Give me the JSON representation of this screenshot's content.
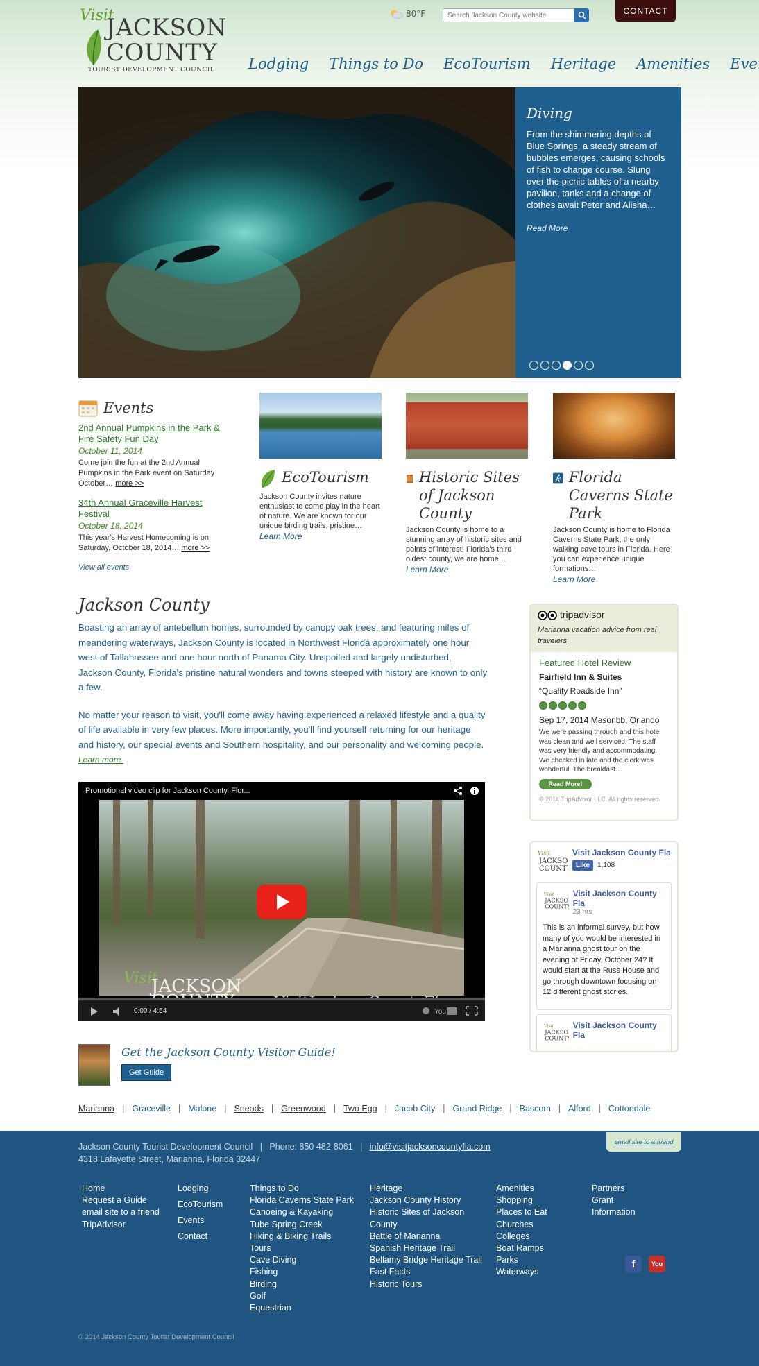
{
  "header": {
    "logo": {
      "visit": "Visit",
      "jackson": "JACKSON",
      "county": "COUNTY",
      "subtitle": "TOURIST DEVELOPMENT COUNCIL"
    },
    "weather": {
      "temp": "80°F",
      "icon": "partly-cloudy-icon"
    },
    "search": {
      "placeholder": "Search Jackson County website"
    },
    "contact_label": "CONTACT",
    "nav": [
      "Lodging",
      "Things to Do",
      "EcoTourism",
      "Heritage",
      "Amenities",
      "Events"
    ]
  },
  "hero": {
    "title": "Diving",
    "text": "From the shimmering depths of Blue Springs, a steady stream of bubbles emerges, causing schools of fish to change course. Slung over the picnic tables of a nearby pavilion, tanks and a change of clothes await Peter and Alisha…",
    "read_more": "Read More",
    "slide_count": 6,
    "active_slide": 4
  },
  "events": {
    "title": "Events",
    "items": [
      {
        "title": "2nd Annual Pumpkins in the Park & Fire Safety Fun Day",
        "date": "October 11, 2014",
        "text": "Come join the fun at the 2nd Annual Pumpkins in the Park event on Saturday October…",
        "more": "more >>"
      },
      {
        "title": "34th Annual Graceville Harvest Festival",
        "date": "October 18, 2014",
        "text": "This year's Harvest Homecoming  is on Saturday, October 18, 2014…",
        "more": "more >>"
      }
    ],
    "view_all": "View all events"
  },
  "features": [
    {
      "title": "EcoTourism",
      "icon": "leaf-icon",
      "text": "Jackson County invites nature enthusiast to come play in the heart of nature. We are known for our unique birding trails, pristine…",
      "more": "Learn More"
    },
    {
      "title": "Historic Sites of Jackson County",
      "icon": "scroll-icon",
      "text": "Jackson County is home to a stunning array of historic sites and points of interest! Florida's third oldest county, we are home…",
      "more": "Learn More"
    },
    {
      "title": "Florida Caverns State Park",
      "icon": "hiker-icon",
      "text": "Jackson County is home to Florida Caverns State Park, the only walking cave tours in Florida. Here you can experience unique formations…",
      "more": "Learn More"
    }
  ],
  "about": {
    "title": "Jackson County",
    "p1": "Boasting an array of antebellum homes, surrounded by canopy oak trees, and featuring miles of meandering waterways, Jackson County is located in Northwest Florida approximately one hour west of Tallahassee and one hour north of Panama City. Unspoiled and largely undisturbed, Jackson County, Florida's pristine natural wonders and towns steeped with history are known to only a few.",
    "p2": "No matter your reason to visit, you'll come away having experienced a relaxed lifestyle and a quality of life available in very few places.  More importantly, you'll find yourself returning for our heritage and history, our special events and Southern hospitality, and our personality and welcoming people. ",
    "learn_more": "Learn more."
  },
  "video": {
    "title": "Promotional video clip for Jackson County, Flor...",
    "time": "0:00 / 4:54",
    "watermark_visit": "Visit",
    "watermark_jackson": "JACKSON",
    "watermark_county": "COUNTY",
    "watermark_url": "www.VisitJacksonCountyFla.com"
  },
  "guide": {
    "title": "Get the Jackson County Visitor Guide!",
    "button": "Get Guide"
  },
  "towns": [
    {
      "name": "Marianna",
      "underlined": true
    },
    {
      "name": "Graceville",
      "underlined": false
    },
    {
      "name": "Malone",
      "underlined": false
    },
    {
      "name": "Sneads",
      "underlined": true
    },
    {
      "name": "Greenwood",
      "underlined": true
    },
    {
      "name": "Two Egg",
      "underlined": true
    },
    {
      "name": "Jacob City",
      "underlined": false
    },
    {
      "name": "Grand Ridge",
      "underlined": false
    },
    {
      "name": "Bascom",
      "underlined": false
    },
    {
      "name": "Alford",
      "underlined": false
    },
    {
      "name": "Cottondale",
      "underlined": false
    }
  ],
  "tripadvisor": {
    "brand": "tripadvisor",
    "link": "Marianna vacation advice from real travelers",
    "featured": "Featured Hotel Review",
    "hotel": "Fairfield Inn & Suites",
    "quote": "“Quality Roadside Inn”",
    "rating": 5,
    "date": "Sep 17, 2014  Masonbb, Orlando",
    "review": "We were passing through and this hotel was clean and well serviced. The staff was very friendly and accommodating. We checked in late and the clerk was wonderful. The breakfast…",
    "read_more": "Read More!",
    "copyright": "© 2014 TripAdvisor LLC. All rights reserved."
  },
  "facebook": {
    "page_name": "Visit Jackson County Fla",
    "like_label": "Like",
    "like_count": "1,108",
    "post_author": "Visit Jackson County Fla",
    "post_time": "23 hrs",
    "post_text": "This is an informal survey, but how many of you would be interested in a Marianna ghost tour on the evening of Friday, October 24? It would start at the Russ House and go through downtown focusing on 12 different ghost stories.",
    "post2_author": "Visit Jackson County Fla"
  },
  "footer": {
    "org": "Jackson County Tourist Development Council",
    "phone": "Phone: 850 482-8061",
    "email": "info@visitjacksoncountyfla.com",
    "address": "4318 Lafayette Street, Marianna, Florida 32447",
    "email_friend": "email site to a friend",
    "col1": [
      "Home",
      "Request a Guide",
      "email site to a friend",
      "TripAdvisor"
    ],
    "col2": [
      "Lodging",
      "EcoTourism",
      "Events",
      "Contact"
    ],
    "col3": [
      "Things to Do",
      "Florida Caverns State Park",
      "Canoeing & Kayaking",
      "Tube Spring Creek",
      "Hiking & Biking Trails",
      "Tours",
      "Cave Diving",
      "Fishing",
      "Birding",
      "Golf",
      "Equestrian"
    ],
    "col4": [
      "Heritage",
      "Jackson County History",
      "Historic Sites of Jackson",
      "County",
      "Battle of Marianna",
      "Spanish Heritage Trail",
      "Bellamy Bridge Heritage Trail",
      "Fast Facts",
      "Historic Tours"
    ],
    "col5": [
      "Amenities",
      "Shopping",
      "Places to Eat",
      "Churches",
      "Colleges",
      "Boat Ramps",
      "Parks",
      "Waterways"
    ],
    "col6": [
      "Partners",
      "Grant",
      "Information"
    ],
    "social": [
      "facebook-icon",
      "youtube-icon"
    ],
    "copyright": "© 2014 Jackson County Tourist Development Council"
  }
}
